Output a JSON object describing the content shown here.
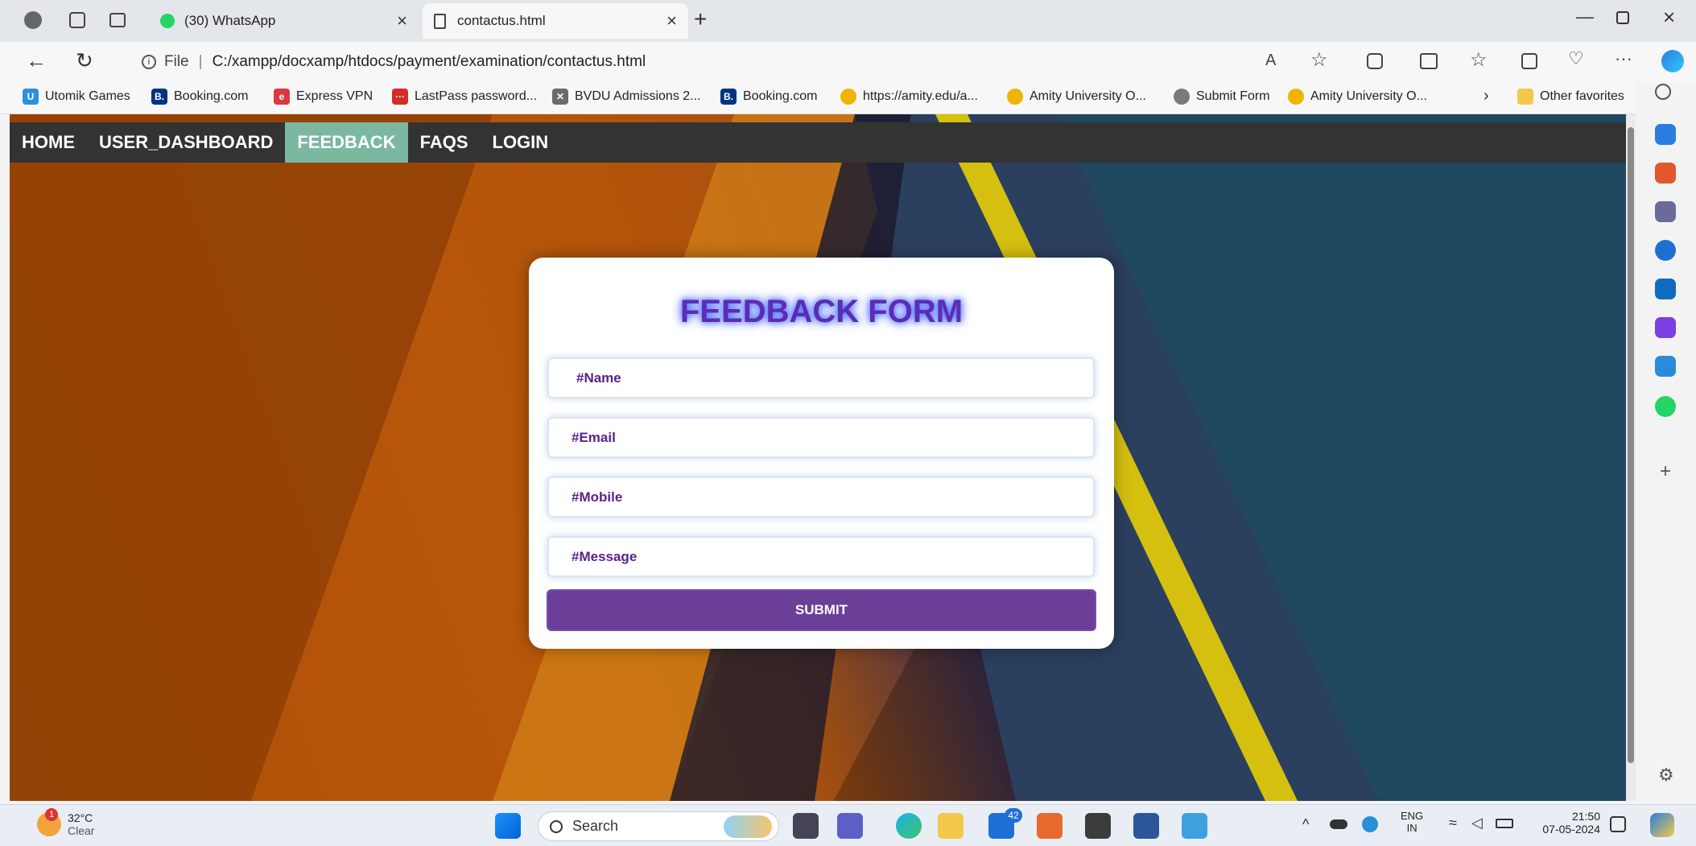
{
  "browser": {
    "tabs": [
      {
        "label": "(30) WhatsApp"
      },
      {
        "label": "contactus.html"
      }
    ],
    "address": {
      "prefix": "File",
      "url": "C:/xampp/docxamp/htdocs/payment/examination/contactus.html"
    },
    "favorites": [
      {
        "label": "Utomik Games",
        "color": "#2f8fdc"
      },
      {
        "label": "Booking.com",
        "color": "#003580"
      },
      {
        "label": "Express VPN",
        "color": "#da3940"
      },
      {
        "label": "LastPass password...",
        "color": "#d32d27"
      },
      {
        "label": "BVDU Admissions 2...",
        "color": "#6b6b6b"
      },
      {
        "label": "Booking.com",
        "color": "#003580"
      },
      {
        "label": "https://amity.edu/a...",
        "color": "#f0b400"
      },
      {
        "label": "Amity University O...",
        "color": "#f0b400"
      },
      {
        "label": "Submit Form",
        "color": "#7a7a7a"
      },
      {
        "label": "Amity University O...",
        "color": "#f0b400"
      }
    ],
    "other_favorites": "Other favorites"
  },
  "nav": {
    "items": [
      {
        "label": "HOME"
      },
      {
        "label": "USER_DASHBOARD"
      },
      {
        "label": "FEEDBACK",
        "active": true
      },
      {
        "label": "FAQS"
      },
      {
        "label": "LOGIN"
      }
    ]
  },
  "form": {
    "title": "FEEDBACK FORM",
    "fields": {
      "name": "#Name",
      "email": "#Email",
      "mobile": "#Mobile",
      "message": "#Message"
    },
    "submit": "SUBMIT"
  },
  "taskbar": {
    "weather": {
      "temp": "32°C",
      "condition": "Clear",
      "badge": "1"
    },
    "search_placeholder": "Search",
    "mail_badge": "42",
    "lang_top": "ENG",
    "lang_bottom": "IN",
    "time": "21:50",
    "date": "07-05-2024"
  },
  "colors": {
    "nav_bg": "#333333",
    "nav_active": "#7ab8a0",
    "submit_bg": "#6b3f97",
    "title_color": "#5b2db5"
  }
}
